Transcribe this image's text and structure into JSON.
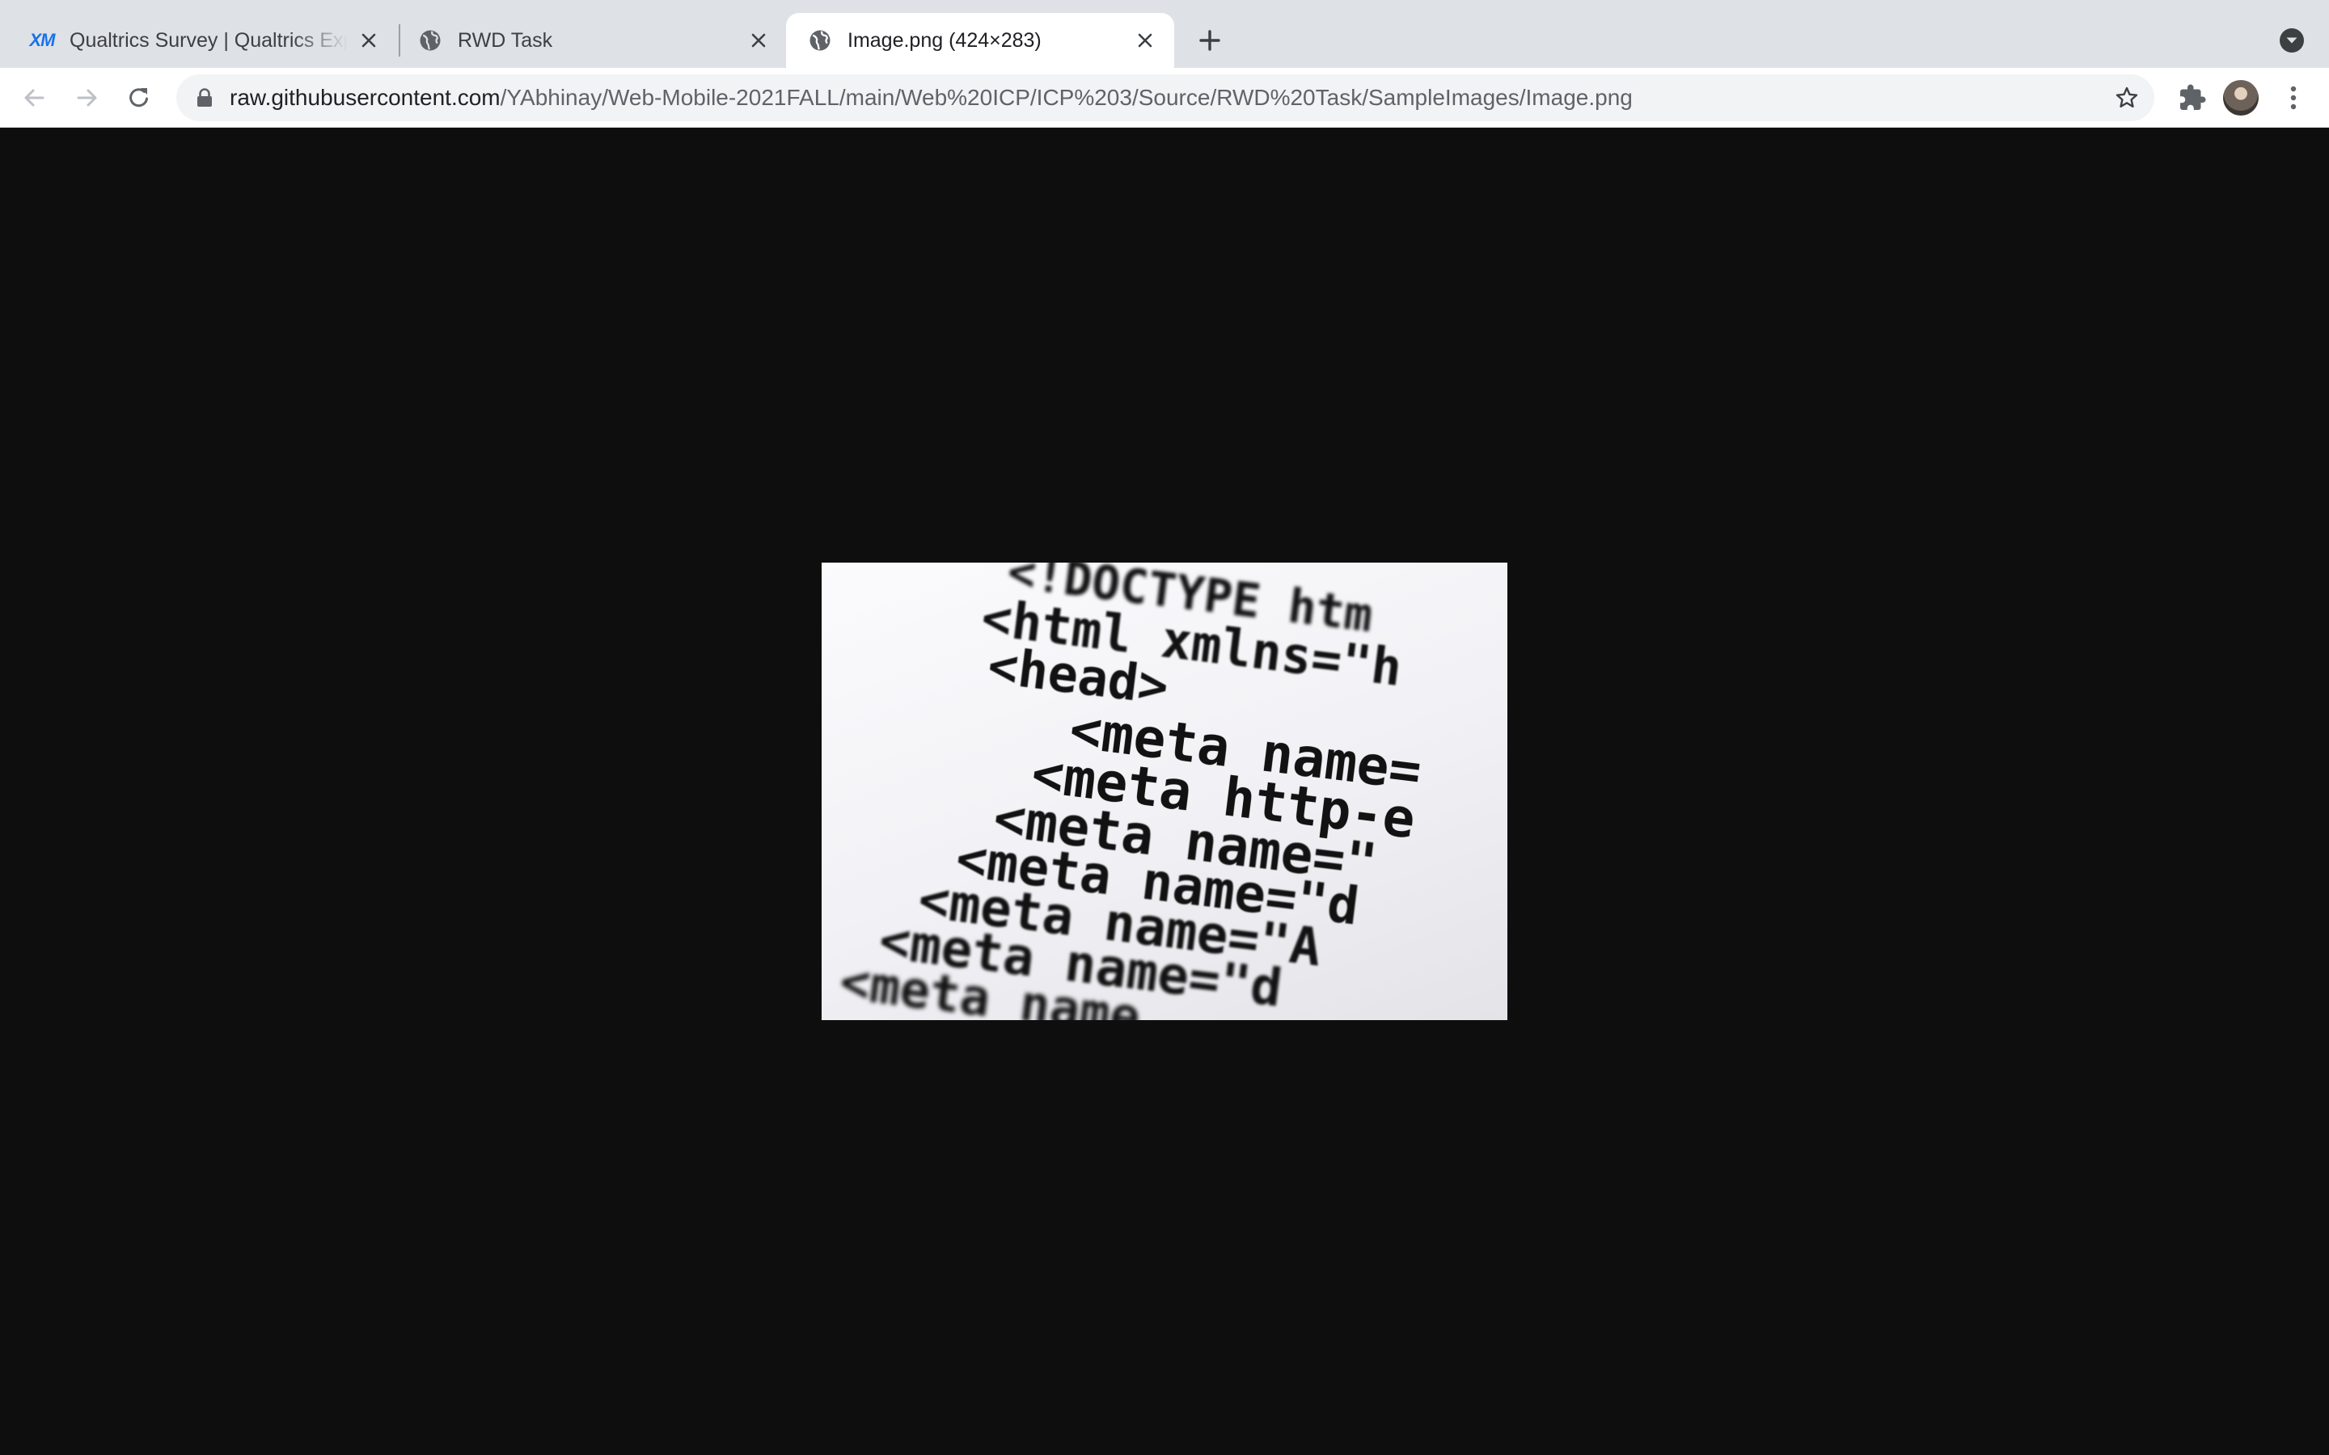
{
  "tabs": [
    {
      "title": "Qualtrics Survey | Qualtrics Experience Management",
      "favicon": "xm-logo-icon",
      "favicon_text": "XM",
      "active": false
    },
    {
      "title": "RWD Task",
      "favicon": "globe-icon",
      "active": false
    },
    {
      "title": "Image.png (424×283)",
      "favicon": "globe-icon",
      "active": true
    }
  ],
  "omnibox": {
    "host": "raw.githubusercontent.com",
    "path": "/YAbhinay/Web-Mobile-2021FALL/main/Web%20ICP/ICP%203/Source/RWD%20Task/SampleImages/Image.png"
  },
  "image": {
    "code_lines": [
      "<!DOCTYPE htm",
      "<html xmlns=\"h",
      "<head>",
      "<meta name=",
      "<meta http-e",
      "<meta name=\"",
      "<meta name=\"d",
      "<meta name=\"A",
      "<meta name=\"d",
      "<meta name"
    ]
  },
  "colors": {
    "tabstrip": "#dee1e6",
    "toolbar": "#ffffff",
    "omnibox": "#f1f3f4",
    "page_background": "#0e0e0e",
    "icon": "#5f6368"
  }
}
